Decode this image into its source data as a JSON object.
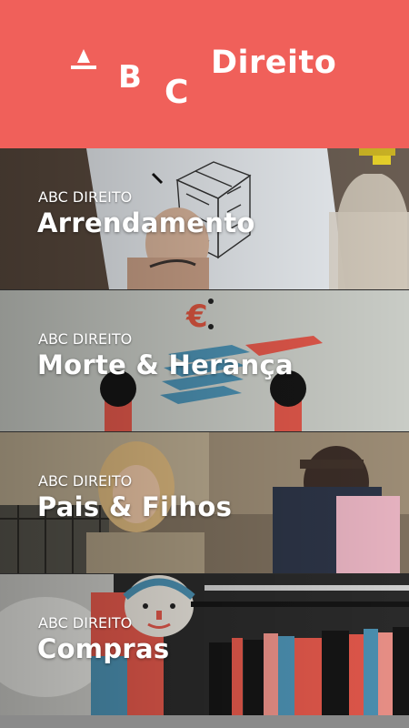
{
  "header": {
    "logo_letters": [
      "A",
      "B",
      "C"
    ],
    "logo_word": "Direito",
    "background": "#f0605a"
  },
  "cards": [
    {
      "kicker": "ABC DIREITO",
      "title": "Arrendamento"
    },
    {
      "kicker": "ABC DIREITO",
      "title": "Morte & Herança"
    },
    {
      "kicker": "ABC DIREITO",
      "title": "Pais & Filhos"
    },
    {
      "kicker": "ABC DIREITO",
      "title": "Compras"
    }
  ],
  "colors": {
    "accent": "#f0605a",
    "illustration_red": "#e0574a",
    "illustration_blue": "#4b8fb0"
  }
}
